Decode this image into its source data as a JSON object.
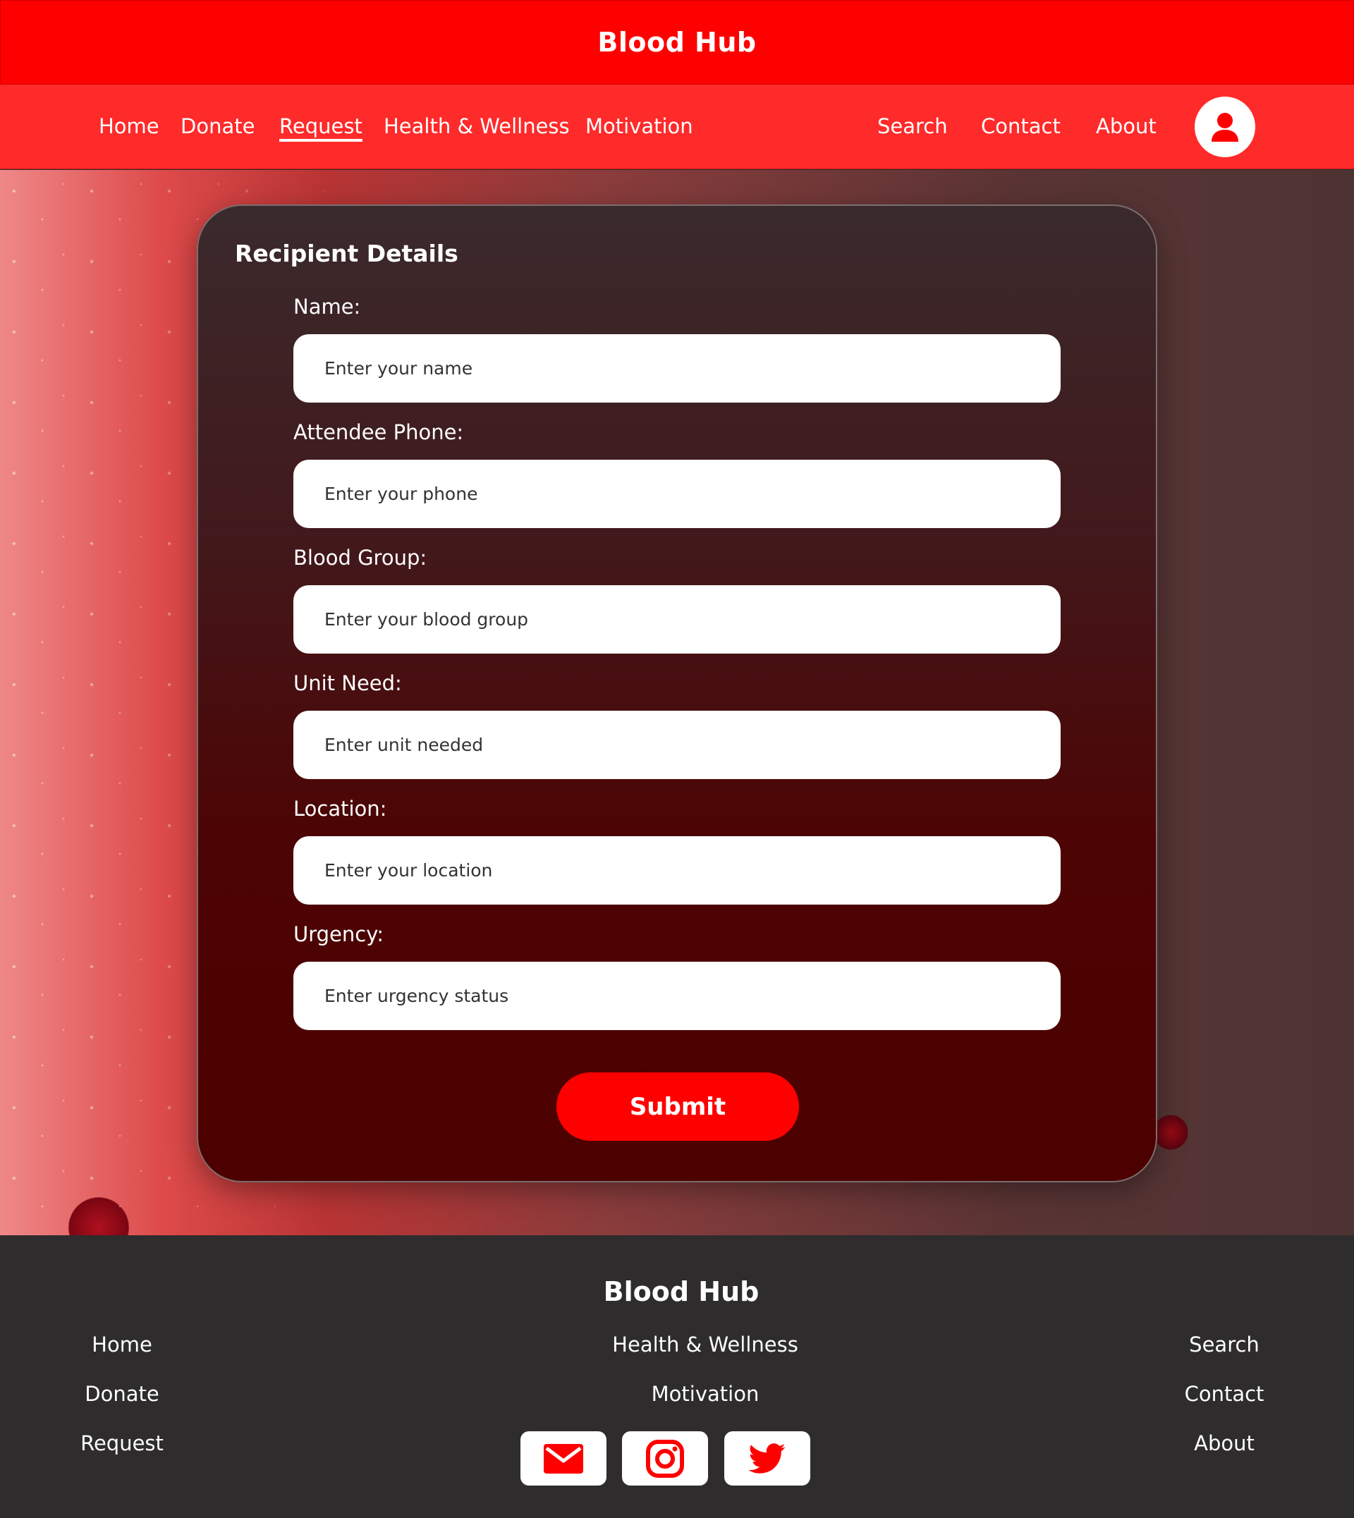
{
  "header": {
    "brand": "Blood Hub"
  },
  "nav": {
    "left": [
      "Home",
      "Donate",
      "Request",
      "Health & Wellness",
      "Motivation"
    ],
    "right": [
      "Search",
      "Contact",
      "About"
    ],
    "active": "Request"
  },
  "form": {
    "title": "Recipient Details",
    "fields": [
      {
        "label": "Name:",
        "placeholder": "Enter your name"
      },
      {
        "label": "Attendee Phone:",
        "placeholder": "Enter your phone"
      },
      {
        "label": "Blood Group:",
        "placeholder": "Enter your blood group"
      },
      {
        "label": "Unit Need:",
        "placeholder": "Enter unit needed"
      },
      {
        "label": "Location:",
        "placeholder": "Enter your location"
      },
      {
        "label": "Urgency:",
        "placeholder": "Enter urgency status"
      }
    ],
    "submit_label": "Submit"
  },
  "footer": {
    "brand": "Blood Hub",
    "col_left": [
      "Home",
      "Donate",
      "Request"
    ],
    "col_center": [
      "Health & Wellness",
      "Motivation"
    ],
    "col_right": [
      "Search",
      "Contact",
      "About"
    ],
    "social_icons": [
      "mail-icon",
      "instagram-icon",
      "twitter-icon"
    ]
  },
  "colors": {
    "brand_red": "#ff0000",
    "nav_red": "#ff2a2a",
    "card_bottom": "#4d0000",
    "footer_bg": "#2e2c2d"
  }
}
